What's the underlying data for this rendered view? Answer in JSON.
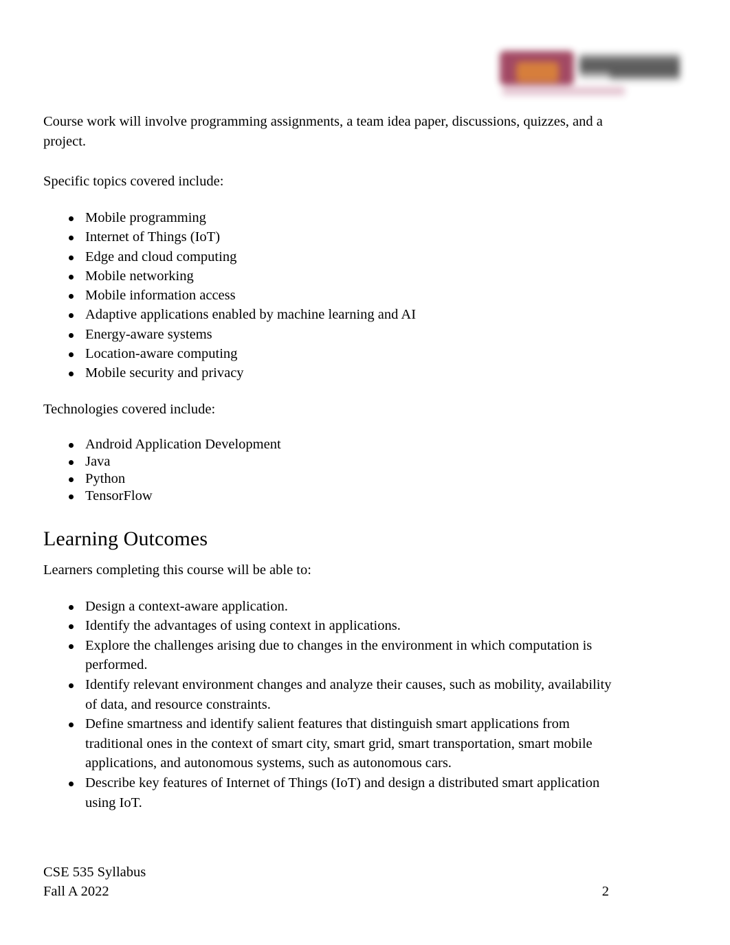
{
  "document": {
    "logo": {
      "name": "asu-engineering-logo",
      "mark_color": "#9b3a57",
      "mark_accent_color": "#d3742c",
      "wordmark_color": "#3c3c3c",
      "tagline_color": "#aa466e"
    }
  },
  "body": {
    "intro_paragraph": "Course work will involve programming assignments, a team idea paper, discussions, quizzes, and a project.",
    "topics_lead_in": "Specific topics covered include:",
    "topics": [
      "Mobile programming",
      "Internet of Things (IoT)",
      "Edge and cloud computing",
      "Mobile networking",
      "Mobile information access",
      "Adaptive applications enabled by machine learning and AI",
      "Energy-aware systems",
      "Location-aware computing",
      "Mobile security and privacy"
    ],
    "technologies_lead_in": "Technologies covered include:",
    "technologies": [
      "Android Application Development",
      "Java",
      "Python",
      "TensorFlow"
    ],
    "learning_outcomes_heading": "Learning Outcomes",
    "learning_outcomes_lead_in": "Learners completing this course will be able to:",
    "learning_outcomes": [
      "Design a context-aware application.",
      "Identify the advantages of using context in applications.",
      "Explore the challenges arising due to changes in the environment in which computation is performed.",
      "Identify relevant environment changes and analyze their causes, such as mobility, availability of data, and resource constraints.",
      "Define smartness and identify salient features that distinguish smart applications from traditional ones in the context of smart city, smart grid, smart transportation, smart mobile applications, and autonomous systems, such as autonomous cars.",
      "Describe key features of Internet of Things (IoT) and design a distributed smart application using IoT."
    ]
  },
  "footer": {
    "line1": "CSE 535 Syllabus",
    "line2": "Fall A 2022",
    "page_number": "2"
  }
}
